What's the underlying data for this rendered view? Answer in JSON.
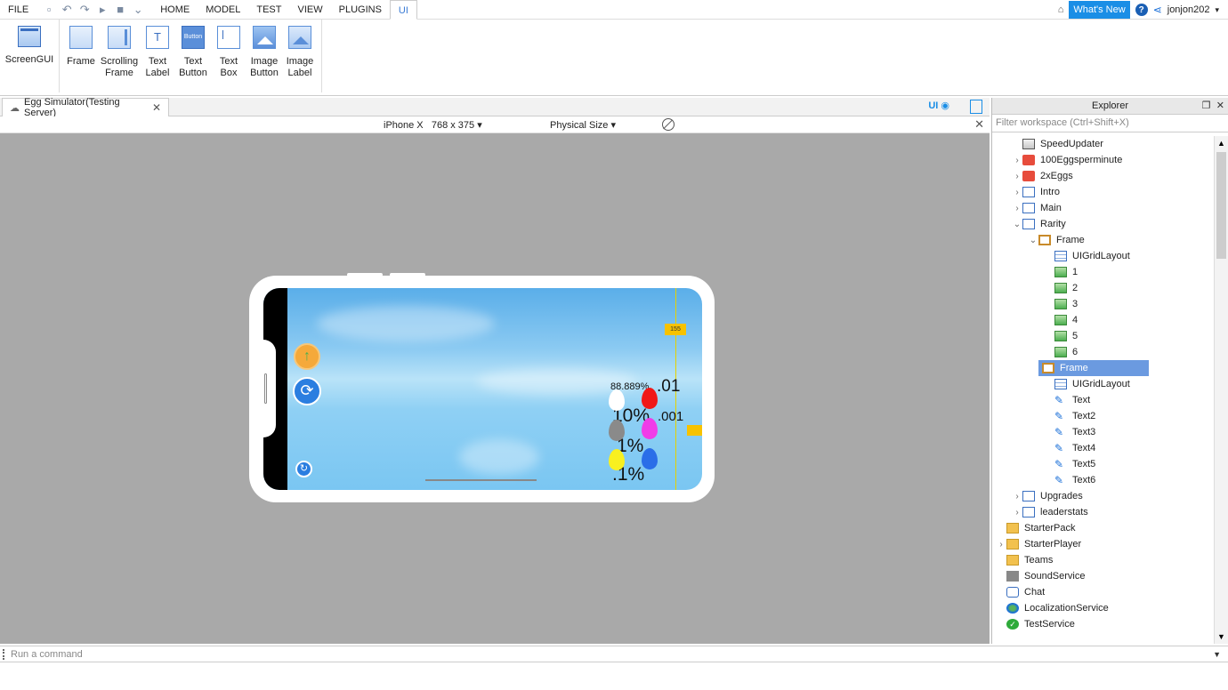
{
  "menubar": {
    "file": "FILE",
    "tabs": [
      "HOME",
      "MODEL",
      "TEST",
      "VIEW",
      "PLUGINS",
      "UI"
    ],
    "active_tab": "UI",
    "whats_new": "What's New",
    "help": "?",
    "username": "jonjon202"
  },
  "ribbon": {
    "screengui": "ScreenGUI",
    "tools": [
      {
        "line1": "Frame",
        "line2": ""
      },
      {
        "line1": "Scrolling",
        "line2": "Frame"
      },
      {
        "line1": "Text",
        "line2": "Label"
      },
      {
        "line1": "Text",
        "line2": "Button"
      },
      {
        "line1": "Text",
        "line2": "Box"
      },
      {
        "line1": "Image",
        "line2": "Button"
      },
      {
        "line1": "Image",
        "line2": "Label"
      }
    ],
    "textlabel_glyph": "T",
    "button_glyph": "Button"
  },
  "doc_tab": {
    "title": "Egg Simulator(Testing Server)",
    "close": "✕"
  },
  "ui_toggle": "UI",
  "device": {
    "name": "iPhone X",
    "size": "768 x 375",
    "size_mode": "Physical Size"
  },
  "game": {
    "count_tag": "155",
    "pct_88": "88.889%",
    "pct_01": ".01",
    "pct_10": "10%",
    "pct_001": ".001",
    "pct_1": "1%",
    "pct_01b": ".1%",
    "egg_colors": [
      "#ffffff",
      "#f01818",
      "#8a8a8a",
      "#f03ce8",
      "#f8f020",
      "#2a6ee8"
    ]
  },
  "explorer": {
    "title": "Explorer",
    "filter_placeholder": "Filter workspace (Ctrl+Shift+X)",
    "items": [
      {
        "label": "SpeedUpdater",
        "icon": "script",
        "depth": 1,
        "arrow": ""
      },
      {
        "label": "100Eggsperminute",
        "icon": "local",
        "depth": 1,
        "arrow": ">"
      },
      {
        "label": "2xEggs",
        "icon": "local",
        "depth": 1,
        "arrow": ">"
      },
      {
        "label": "Intro",
        "icon": "gui",
        "depth": 1,
        "arrow": ">"
      },
      {
        "label": "Main",
        "icon": "gui",
        "depth": 1,
        "arrow": ">"
      },
      {
        "label": "Rarity",
        "icon": "gui",
        "depth": 1,
        "arrow": "v"
      },
      {
        "label": "Frame",
        "icon": "frame",
        "depth": 2,
        "arrow": "v"
      },
      {
        "label": "UIGridLayout",
        "icon": "grid",
        "depth": 3,
        "arrow": ""
      },
      {
        "label": "1",
        "icon": "img",
        "depth": 3,
        "arrow": ""
      },
      {
        "label": "2",
        "icon": "img",
        "depth": 3,
        "arrow": ""
      },
      {
        "label": "3",
        "icon": "img",
        "depth": 3,
        "arrow": ""
      },
      {
        "label": "4",
        "icon": "img",
        "depth": 3,
        "arrow": ""
      },
      {
        "label": "5",
        "icon": "img",
        "depth": 3,
        "arrow": ""
      },
      {
        "label": "6",
        "icon": "img",
        "depth": 3,
        "arrow": ""
      },
      {
        "label": "Frame",
        "icon": "frame",
        "depth": 2,
        "arrow": "v",
        "selected": true
      },
      {
        "label": "UIGridLayout",
        "icon": "grid",
        "depth": 3,
        "arrow": ""
      },
      {
        "label": "Text",
        "icon": "text",
        "depth": 3,
        "arrow": ""
      },
      {
        "label": "Text2",
        "icon": "text",
        "depth": 3,
        "arrow": ""
      },
      {
        "label": "Text3",
        "icon": "text",
        "depth": 3,
        "arrow": ""
      },
      {
        "label": "Text4",
        "icon": "text",
        "depth": 3,
        "arrow": ""
      },
      {
        "label": "Text5",
        "icon": "text",
        "depth": 3,
        "arrow": ""
      },
      {
        "label": "Text6",
        "icon": "text",
        "depth": 3,
        "arrow": ""
      },
      {
        "label": "Upgrades",
        "icon": "gui",
        "depth": 1,
        "arrow": ">"
      },
      {
        "label": "leaderstats",
        "icon": "gui",
        "depth": 1,
        "arrow": ">"
      },
      {
        "label": "StarterPack",
        "icon": "folder",
        "depth": 0,
        "arrow": ""
      },
      {
        "label": "StarterPlayer",
        "icon": "folder",
        "depth": 0,
        "arrow": ">"
      },
      {
        "label": "Teams",
        "icon": "folder",
        "depth": 0,
        "arrow": ""
      },
      {
        "label": "SoundService",
        "icon": "sound",
        "depth": 0,
        "arrow": ""
      },
      {
        "label": "Chat",
        "icon": "chat",
        "depth": 0,
        "arrow": ""
      },
      {
        "label": "LocalizationService",
        "icon": "globe",
        "depth": 0,
        "arrow": ""
      },
      {
        "label": "TestService",
        "icon": "check",
        "depth": 0,
        "arrow": ""
      }
    ]
  },
  "command_bar": {
    "placeholder": "Run a command"
  }
}
